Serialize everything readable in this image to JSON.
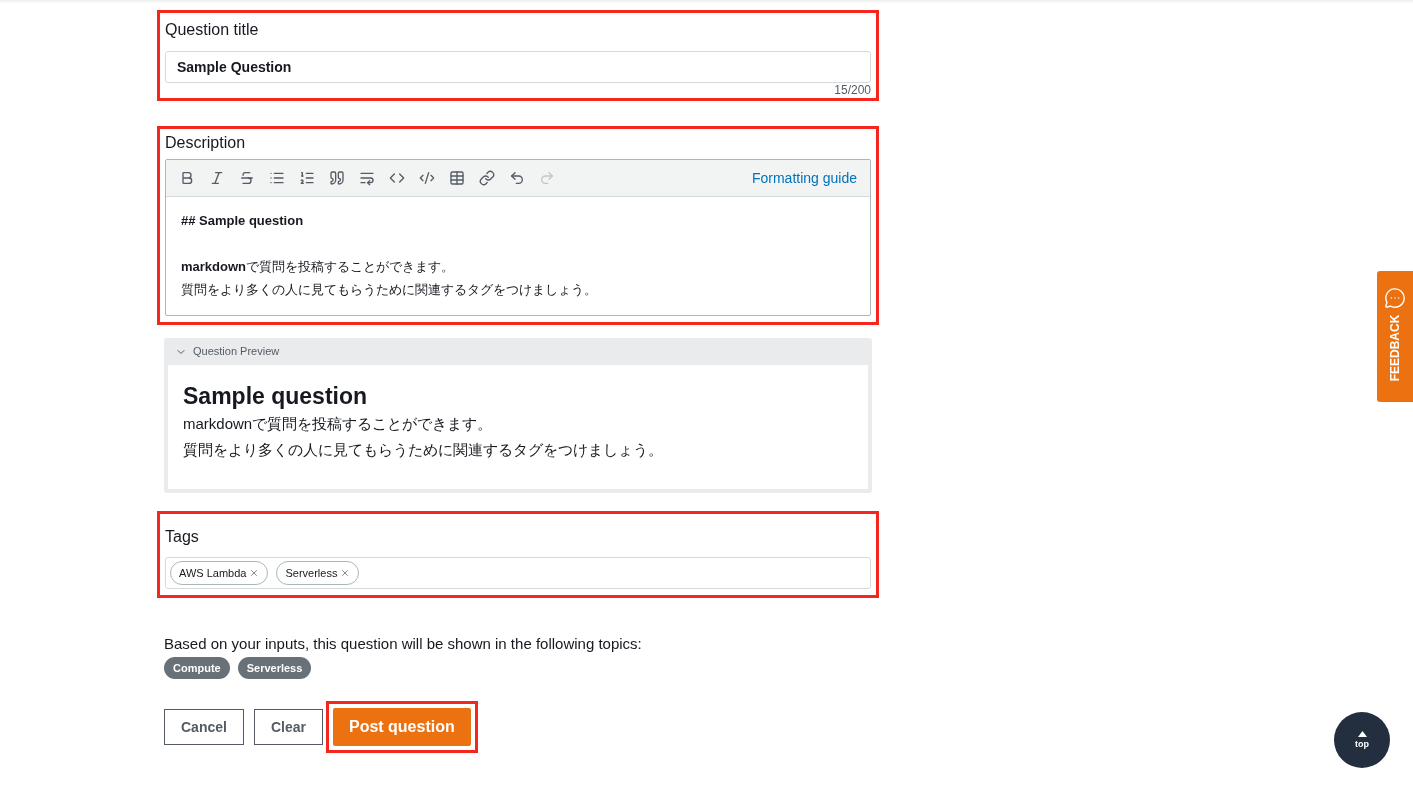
{
  "title_field": {
    "label": "Question title",
    "value": "Sample Question",
    "counter": "15/200"
  },
  "description": {
    "label": "Description",
    "formatting_link": "Formatting guide",
    "lines": [
      {
        "kind": "heading",
        "text": "## Sample question"
      },
      {
        "kind": "text",
        "text": "**markdown**で質問を投稿することができます。"
      },
      {
        "kind": "text",
        "text": "質問をより多くの人に見てもらうために関連するタグをつけましょう。"
      }
    ]
  },
  "preview": {
    "label": "Question Preview",
    "expanded": true,
    "heading": "Sample question",
    "lines": [
      "markdownで質問を投稿することができます。",
      "質問をより多くの人に見てもらうために関連するタグをつけましょう。"
    ]
  },
  "tags": {
    "label": "Tags",
    "items": [
      "AWS Lambda",
      "Serverless"
    ]
  },
  "topics": {
    "text": "Based on your inputs, this question will be shown in the following topics:",
    "items": [
      "Compute",
      "Serverless"
    ]
  },
  "buttons": {
    "cancel": "Cancel",
    "clear": "Clear",
    "post": "Post question"
  },
  "feedback_tab": "FEEDBACK",
  "top_button": "top"
}
